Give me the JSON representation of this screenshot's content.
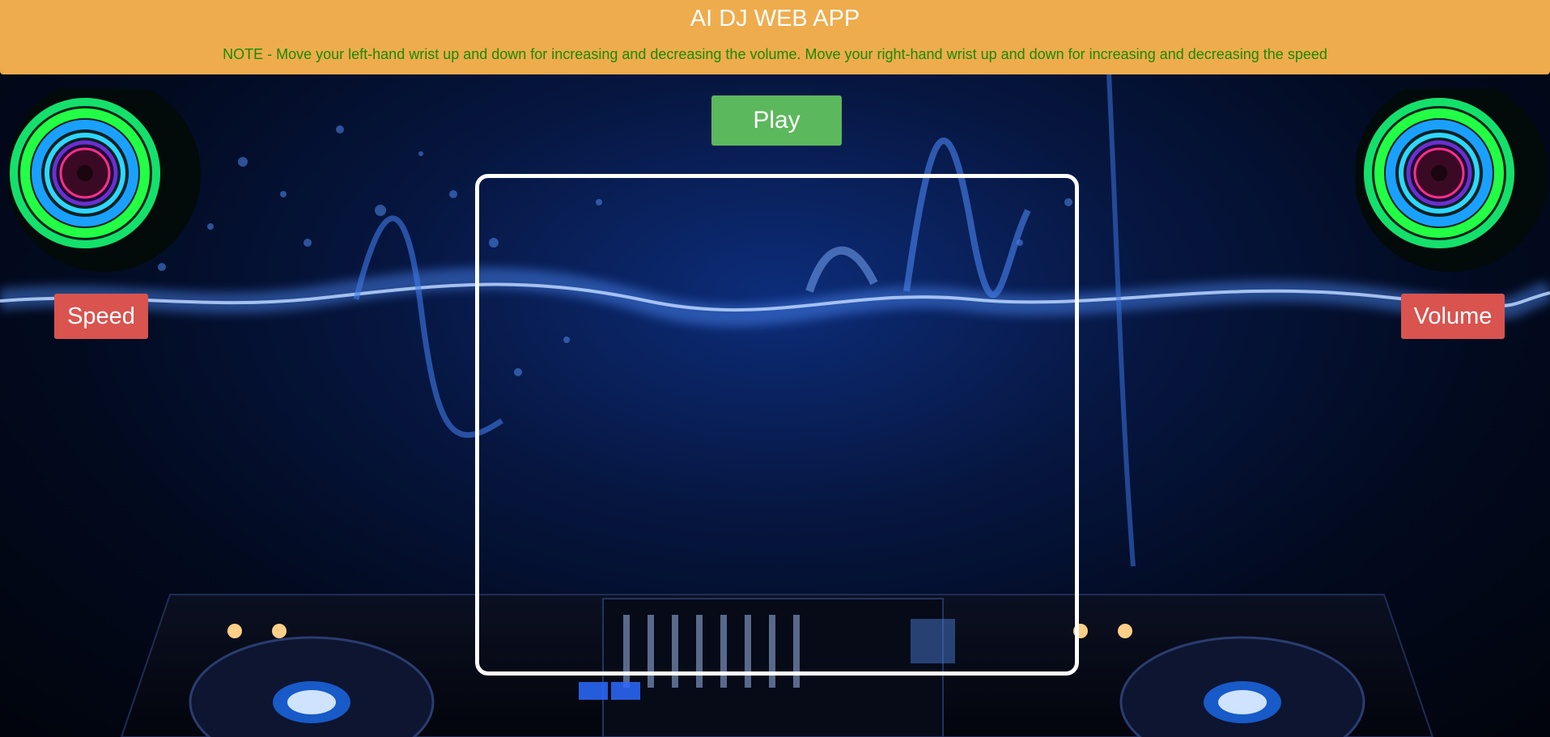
{
  "header": {
    "title": "AI DJ WEB APP",
    "note": "NOTE - Move your left-hand wrist up and down for increasing and decreasing the volume. Move your right-hand wrist up and down for increasing and decreasing the speed"
  },
  "controls": {
    "play_label": "Play",
    "speed_label": "Speed",
    "volume_label": "Volume"
  },
  "colors": {
    "header_bg": "#eeac4d",
    "header_title": "#ffffff",
    "note_text": "#1a8a00",
    "play_button": "#5cb85c",
    "speed_button": "#d9534f",
    "volume_button": "#d9534f",
    "frame_border": "#ffffff"
  },
  "icons": {
    "left_speaker": "speaker-icon",
    "right_speaker": "speaker-icon"
  }
}
